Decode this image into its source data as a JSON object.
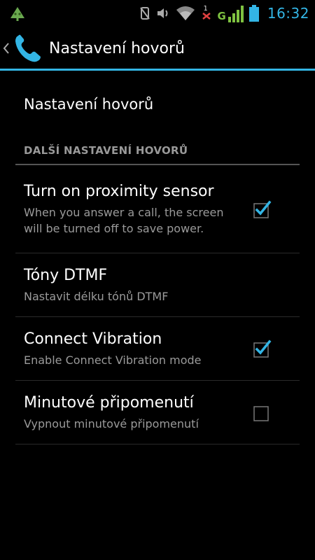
{
  "status_bar": {
    "time": "16:32",
    "network_type": "G",
    "sim_indicator": "1",
    "icons": [
      "android-notification-icon",
      "silent-icon",
      "volume-icon",
      "wifi-icon",
      "no-sim-icon",
      "signal-icon",
      "battery-icon"
    ]
  },
  "action_bar": {
    "title": "Nastavení hovorů"
  },
  "preferences": {
    "top_item": "Nastavení hovorů",
    "category": "DALŠÍ NASTAVENÍ HOVORŮ",
    "items": [
      {
        "title": "Turn on proximity sensor",
        "summary": "When you answer a call, the screen will be turned off to save power.",
        "checked": true
      },
      {
        "title": "Tóny DTMF",
        "summary": "Nastavit délku tónů DTMF"
      },
      {
        "title": "Connect Vibration",
        "summary": "Enable Connect Vibration mode",
        "checked": true
      },
      {
        "title": "Minutové připomenutí",
        "summary": "Vypnout minutové připomenutí",
        "checked": false
      }
    ]
  },
  "colors": {
    "accent": "#33b5e5",
    "background": "#000000",
    "summary_text": "#9a9a9a"
  }
}
